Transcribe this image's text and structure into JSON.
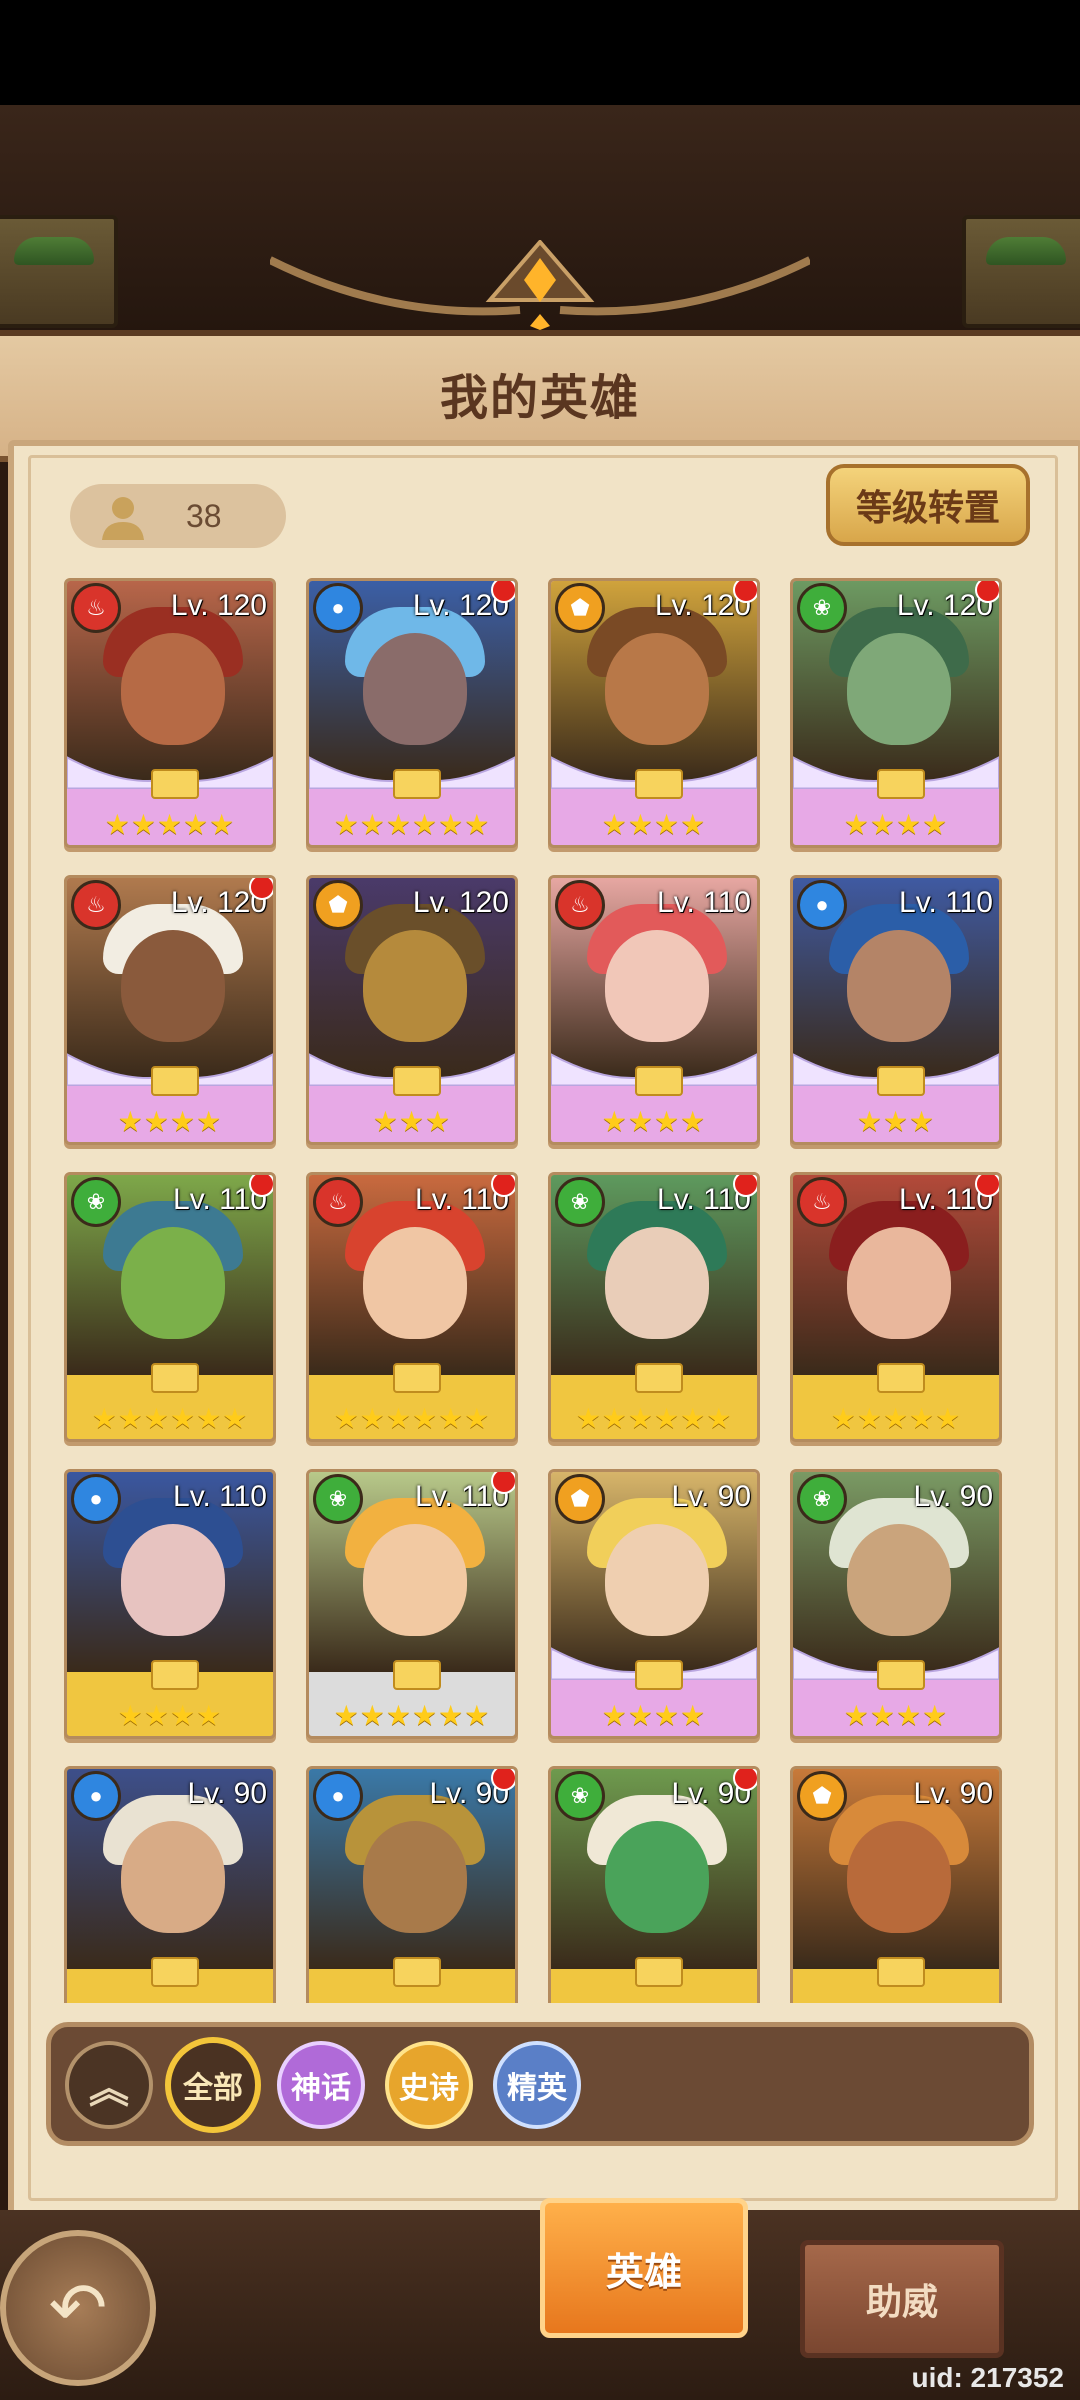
{
  "header": {
    "title": "我的英雄"
  },
  "hero_count": "38",
  "reset_button": "等级转置",
  "heroes": [
    {
      "level": "Lv. 120",
      "element": "fire",
      "elem_color": "#d9342b",
      "stars": "★★★★★",
      "skin": "#b66a45",
      "hair": "#9a2f22",
      "bg": "#b8664a",
      "base": "#e7a9e6",
      "wings": true,
      "dot": false
    },
    {
      "level": "Lv. 120",
      "element": "water",
      "elem_color": "#2f86e0",
      "stars": "★★★★★★",
      "skin": "#8a6c6a",
      "hair": "#6fb8e8",
      "bg": "#3b5fa6",
      "base": "#e7a9e6",
      "wings": true,
      "dot": true
    },
    {
      "level": "Lv. 120",
      "element": "light",
      "elem_color": "#f0a020",
      "stars": "★★★★",
      "skin": "#b87848",
      "hair": "#7a4a25",
      "bg": "#d0a33c",
      "base": "#e7a9e6",
      "wings": true,
      "dot": true
    },
    {
      "level": "Lv. 120",
      "element": "nature",
      "elem_color": "#3fae3b",
      "stars": "★★★★",
      "skin": "#7fa878",
      "hair": "#3e6b4a",
      "bg": "#6d9a62",
      "base": "#e7a9e6",
      "wings": true,
      "dot": true
    },
    {
      "level": "Lv. 120",
      "element": "fire",
      "elem_color": "#d9342b",
      "stars": "★★★★",
      "skin": "#8a5a3c",
      "hair": "#f2ede2",
      "bg": "#b07a4e",
      "base": "#e7a9e6",
      "wings": true,
      "dot": true
    },
    {
      "level": "Lv. 120",
      "element": "light",
      "elem_color": "#f0a020",
      "stars": "★★★",
      "skin": "#b58a3c",
      "hair": "#6a4f2a",
      "bg": "#4a3a6a",
      "base": "#e7a9e6",
      "wings": true,
      "dot": false
    },
    {
      "level": "Lv. 110",
      "element": "fire",
      "elem_color": "#d9342b",
      "stars": "★★★★",
      "skin": "#f1c7b8",
      "hair": "#e25a5a",
      "bg": "#e7a7a2",
      "base": "#e7a9e6",
      "wings": true,
      "dot": false
    },
    {
      "level": "Lv. 110",
      "element": "water",
      "elem_color": "#2f86e0",
      "stars": "★★★",
      "skin": "#b48467",
      "hair": "#2b5ea8",
      "bg": "#3f5aa2",
      "base": "#e7a9e6",
      "wings": true,
      "dot": false
    },
    {
      "level": "Lv. 110",
      "element": "nature",
      "elem_color": "#3fae3b",
      "stars": "★★★★★★",
      "skin": "#7bb04a",
      "hair": "#3d7a92",
      "bg": "#7ea84a",
      "base": "#f0c640",
      "wings": false,
      "dot": true
    },
    {
      "level": "Lv. 110",
      "element": "fire",
      "elem_color": "#d9342b",
      "stars": "★★★★★★",
      "skin": "#f0c6a4",
      "hair": "#d8432e",
      "bg": "#c96a3f",
      "base": "#f0c640",
      "wings": false,
      "dot": true
    },
    {
      "level": "Lv. 110",
      "element": "nature",
      "elem_color": "#3fae3b",
      "stars": "★★★★★★",
      "skin": "#e9cdb8",
      "hair": "#2e7a58",
      "bg": "#5e9a5e",
      "base": "#f0c640",
      "wings": false,
      "dot": true
    },
    {
      "level": "Lv. 110",
      "element": "fire",
      "elem_color": "#d9342b",
      "stars": "★★★★★",
      "skin": "#e9b79c",
      "hair": "#8a1e1e",
      "bg": "#b34a3a",
      "base": "#f0c640",
      "wings": false,
      "dot": true
    },
    {
      "level": "Lv. 110",
      "element": "water",
      "elem_color": "#2f86e0",
      "stars": "★★★★",
      "skin": "#e7c3c0",
      "hair": "#2d4f92",
      "bg": "#3a57a0",
      "base": "#f0c640",
      "wings": false,
      "dot": false
    },
    {
      "level": "Lv. 110",
      "element": "nature",
      "elem_color": "#3fae3b",
      "stars": "★★★★★★",
      "skin": "#f2c9a2",
      "hair": "#f2b140",
      "bg": "#b8c98a",
      "base": "#dcdcdc",
      "wings": false,
      "dot": true
    },
    {
      "level": "Lv. 90",
      "element": "light",
      "elem_color": "#f0a020",
      "stars": "★★★★",
      "skin": "#efcfb0",
      "hair": "#f1cf5a",
      "bg": "#d7b56a",
      "base": "#e7a9e6",
      "wings": true,
      "dot": false
    },
    {
      "level": "Lv. 90",
      "element": "nature",
      "elem_color": "#3fae3b",
      "stars": "★★★★",
      "skin": "#caa47c",
      "hair": "#dfe4d2",
      "bg": "#7a9a64",
      "base": "#e7a9e6",
      "wings": true,
      "dot": false
    },
    {
      "level": "Lv. 90",
      "element": "water",
      "elem_color": "#2f86e0",
      "stars": "",
      "skin": "#d8ab86",
      "hair": "#e9e2d2",
      "bg": "#3d4f8a",
      "base": "#f0c640",
      "wings": false,
      "dot": false
    },
    {
      "level": "Lv. 90",
      "element": "water",
      "elem_color": "#2f86e0",
      "stars": "",
      "skin": "#a87a4a",
      "hair": "#b8933a",
      "bg": "#3a79a8",
      "base": "#f0c640",
      "wings": false,
      "dot": true
    },
    {
      "level": "Lv. 90",
      "element": "nature",
      "elem_color": "#3fae3b",
      "stars": "",
      "skin": "#4aa35a",
      "hair": "#f0e8d6",
      "bg": "#6e9a4e",
      "base": "#f0c640",
      "wings": false,
      "dot": true
    },
    {
      "level": "Lv. 90",
      "element": "light",
      "elem_color": "#f0a020",
      "stars": "",
      "skin": "#b86a3a",
      "hair": "#d88a3a",
      "bg": "#c87a3a",
      "base": "#f0c640",
      "wings": false,
      "dot": false
    }
  ],
  "filters": {
    "all": "全部",
    "myth": "神话",
    "epic": "史诗",
    "elite": "精英"
  },
  "tabs": {
    "hero": "英雄",
    "assist": "助威"
  },
  "uid": "uid: 217352"
}
